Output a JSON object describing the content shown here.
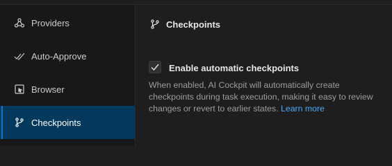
{
  "sidebar": {
    "items": [
      {
        "label": "Providers",
        "icon": "providers-icon"
      },
      {
        "label": "Auto-Approve",
        "icon": "double-check-icon"
      },
      {
        "label": "Browser",
        "icon": "browser-icon"
      },
      {
        "label": "Checkpoints",
        "icon": "git-branch-icon",
        "active": true
      }
    ]
  },
  "main": {
    "section_title": "Checkpoints",
    "checkbox": {
      "label": "Enable automatic checkpoints",
      "checked": true
    },
    "description": "When enabled, AI Cockpit will automatically create checkpoints during task execution, making it easy to review changes or revert to earlier states.",
    "learn_more": "Learn more"
  },
  "colors": {
    "accent": "#0078d4",
    "active_bg": "#04395e",
    "link": "#4daafc"
  }
}
